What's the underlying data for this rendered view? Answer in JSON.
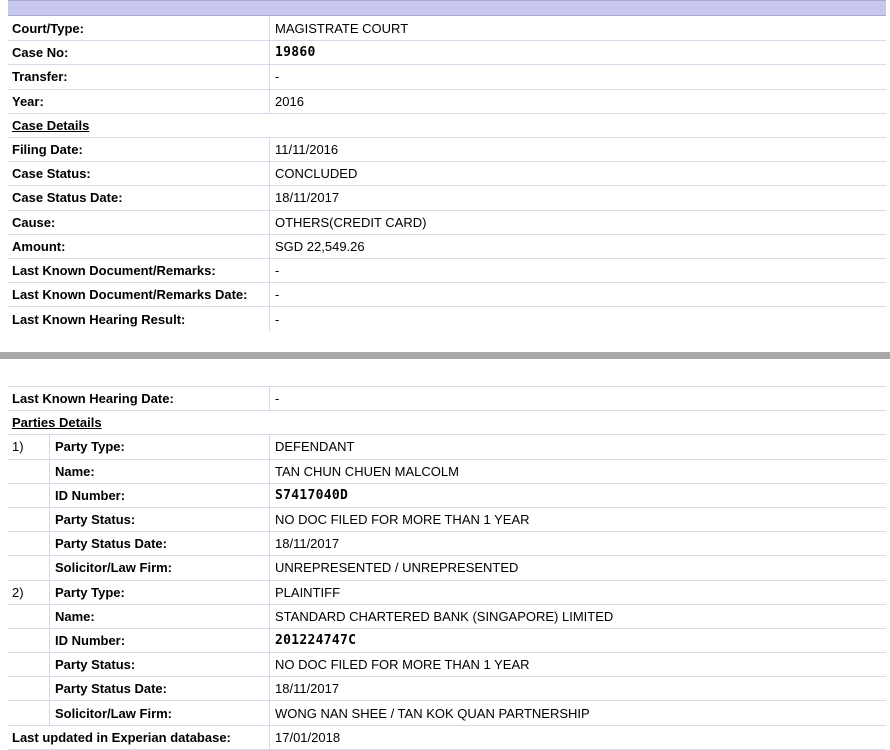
{
  "case": {
    "court_type": {
      "label": "Court/Type:",
      "value": "MAGISTRATE COURT"
    },
    "case_no": {
      "label": "Case No:",
      "value": "19860"
    },
    "transfer": {
      "label": "Transfer:",
      "value": "-"
    },
    "year": {
      "label": "Year:",
      "value": "2016"
    }
  },
  "case_details": {
    "heading": "Case Details",
    "rows": [
      {
        "label": "Filing Date:",
        "value": "11/11/2016"
      },
      {
        "label": "Case Status:",
        "value": "CONCLUDED"
      },
      {
        "label": "Case Status Date:",
        "value": "18/11/2017"
      },
      {
        "label": "Cause:",
        "value": "OTHERS(CREDIT CARD)"
      },
      {
        "label": "Amount:",
        "value": "SGD 22,549.26"
      },
      {
        "label": "Last Known Document/Remarks:",
        "value": "-"
      },
      {
        "label": "Last Known Document/Remarks Date:",
        "value": "-"
      },
      {
        "label": "Last Known Hearing Result:",
        "value": "-"
      },
      {
        "label": "Last Known Hearing Date:",
        "value": "-"
      }
    ]
  },
  "parties": {
    "heading": "Parties Details",
    "list": [
      {
        "num": "1)",
        "party_type": {
          "label": "Party Type:",
          "value": "DEFENDANT"
        },
        "name": {
          "label": "Name:",
          "value": "TAN CHUN CHUEN MALCOLM"
        },
        "id_number": {
          "label": "ID Number:",
          "value": "S7417040D"
        },
        "party_status": {
          "label": "Party Status:",
          "value": "NO DOC FILED FOR MORE THAN 1 YEAR"
        },
        "party_status_date": {
          "label": "Party Status Date:",
          "value": "18/11/2017"
        },
        "solicitor": {
          "label": "Solicitor/Law Firm:",
          "value": "UNREPRESENTED / UNREPRESENTED"
        }
      },
      {
        "num": "2)",
        "party_type": {
          "label": "Party Type:",
          "value": "PLAINTIFF"
        },
        "name": {
          "label": "Name:",
          "value": "STANDARD CHARTERED BANK (SINGAPORE) LIMITED"
        },
        "id_number": {
          "label": "ID Number:",
          "value": "201224747C"
        },
        "party_status": {
          "label": "Party Status:",
          "value": "NO DOC FILED FOR MORE THAN 1 YEAR"
        },
        "party_status_date": {
          "label": "Party Status Date:",
          "value": "18/11/2017"
        },
        "solicitor": {
          "label": "Solicitor/Law Firm:",
          "value": "WONG NAN SHEE / TAN KOK QUAN PARTNERSHIP"
        }
      }
    ]
  },
  "footer": {
    "label": "Last updated in Experian database:",
    "value": "17/01/2018"
  },
  "colors": {
    "header_bar": "#c8c8ee",
    "divider": "#a8a8a8",
    "grid_line": "#d8d8e8"
  }
}
